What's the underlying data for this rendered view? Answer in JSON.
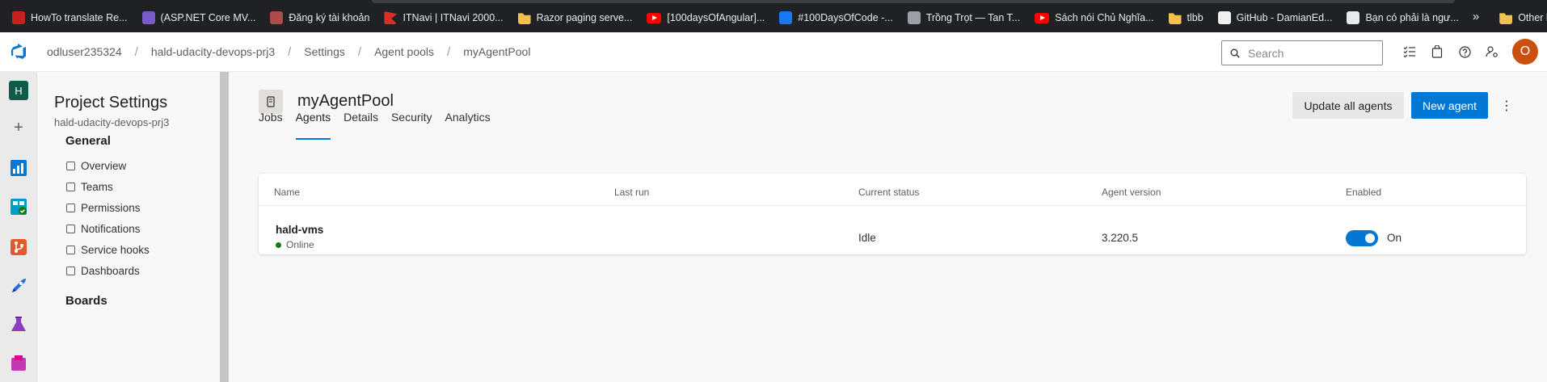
{
  "bookmarks": [
    {
      "label": "HowTo translate Re...",
      "icon": "red-circle-icon"
    },
    {
      "label": "(ASP.NET Core MV...",
      "icon": "netcore-icon"
    },
    {
      "label": "Đăng ký tài khoản",
      "icon": "cloud-icon"
    },
    {
      "label": "ITNavi | ITNavi 2000...",
      "icon": "flag-icon"
    },
    {
      "label": "Razor paging serve...",
      "icon": "folder-icon"
    },
    {
      "label": "[100daysOfAngular]...",
      "icon": "youtube-icon"
    },
    {
      "label": "#100DaysOfCode -...",
      "icon": "facebook-icon"
    },
    {
      "label": "Trồng Trọt — Tan T...",
      "icon": "globe-icon"
    },
    {
      "label": "Sách nói Chủ Nghĩa...",
      "icon": "youtube-icon"
    },
    {
      "label": "tlbb",
      "icon": "folder-icon"
    },
    {
      "label": "GitHub - DamianEd...",
      "icon": "github-icon"
    },
    {
      "label": "Bạn có phải là ngư...",
      "icon": "doc-icon"
    }
  ],
  "bookmarks_overflow": "»",
  "other_bookmarks": "Other bookmarks",
  "breadcrumb": [
    "odluser235324",
    "hald-udacity-devops-prj3",
    "Settings",
    "Agent pools",
    "myAgentPool"
  ],
  "breadcrumb_separator": "/",
  "search": {
    "placeholder": "Search"
  },
  "avatar_initial": "O",
  "project_badge": "H",
  "sidebar": {
    "title": "Project Settings",
    "subtitle": "hald-udacity-devops-prj3",
    "general_header": "General",
    "items": [
      "Overview",
      "Teams",
      "Permissions",
      "Notifications",
      "Service hooks",
      "Dashboards"
    ],
    "boards_header": "Boards"
  },
  "pool": {
    "title": "myAgentPool",
    "update_button": "Update all agents",
    "new_button": "New agent",
    "more": "⋮"
  },
  "tabs": [
    "Jobs",
    "Agents",
    "Details",
    "Security",
    "Analytics"
  ],
  "active_tab": "Agents",
  "table": {
    "columns": [
      "Name",
      "Last run",
      "Current status",
      "Agent version",
      "Enabled"
    ],
    "rows": [
      {
        "name": "hald-vms",
        "state": "Online",
        "last_run": "",
        "status": "Idle",
        "version": "3.220.5",
        "enabled": true,
        "enabled_label": "On"
      }
    ]
  },
  "colors": {
    "accent": "#0078d4",
    "online": "#107c10",
    "avatar": "#ca5010"
  }
}
